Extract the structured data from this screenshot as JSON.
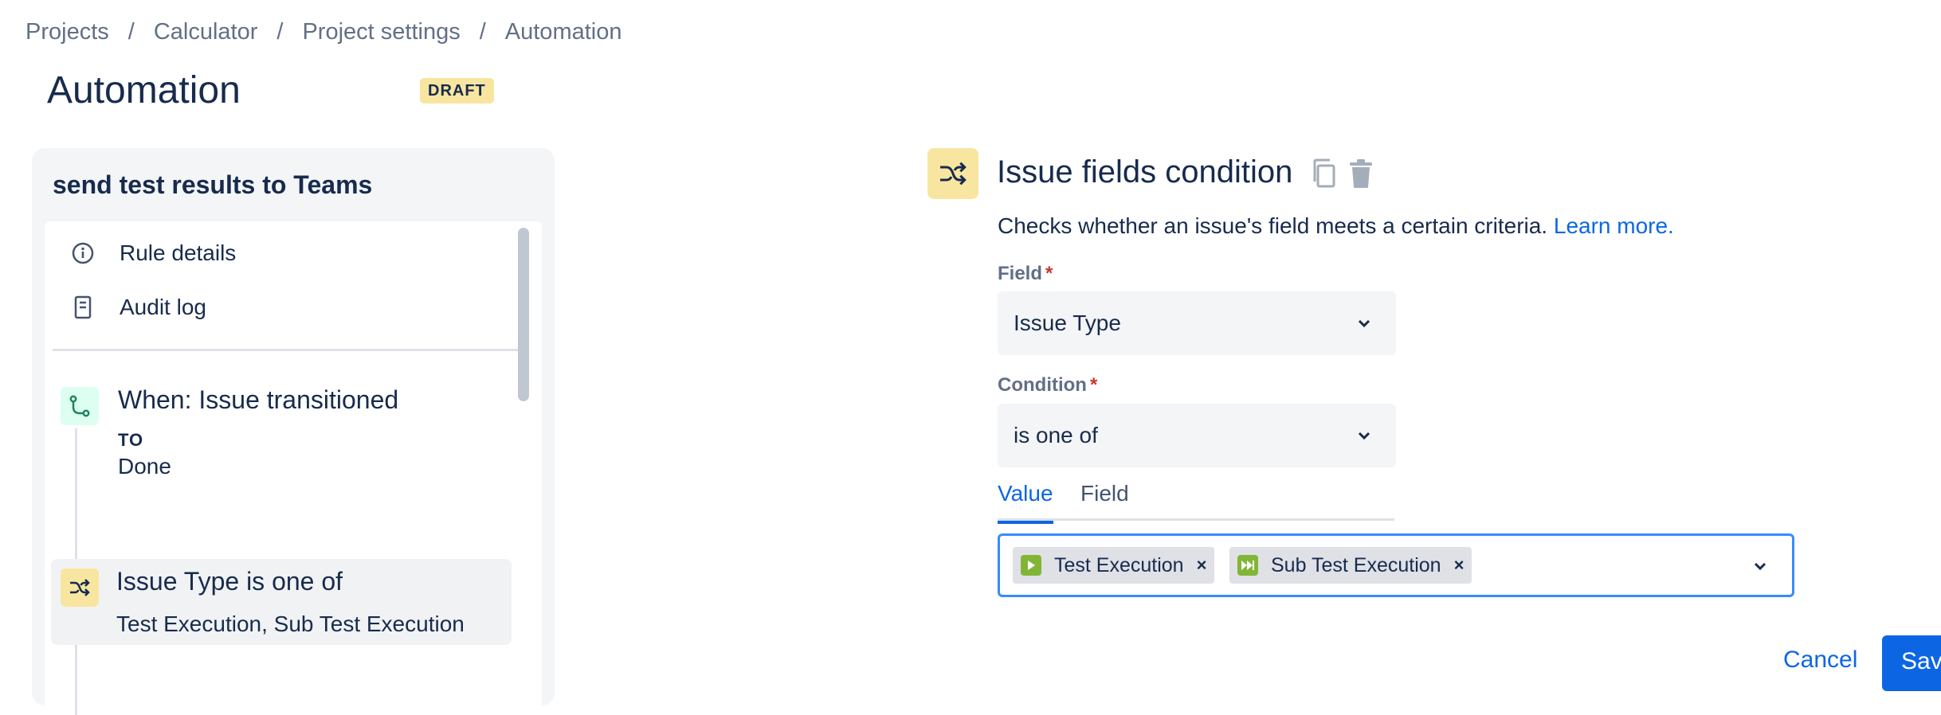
{
  "breadcrumb": {
    "items": [
      "Projects",
      "Calculator",
      "Project settings",
      "Automation"
    ],
    "separator": "/"
  },
  "page": {
    "title": "Automation",
    "status_badge": "DRAFT"
  },
  "rule_panel": {
    "rule_name": "send test results to Teams",
    "menu": [
      {
        "label": "Rule details",
        "icon": "info-icon"
      },
      {
        "label": "Audit log",
        "icon": "document-icon"
      }
    ],
    "trigger": {
      "icon": "transition-icon",
      "title": "When: Issue transitioned",
      "sub_label": "TO",
      "value": "Done"
    },
    "condition": {
      "icon": "shuffle-icon",
      "title": "Issue Type is one of",
      "summary": "Test Execution, Sub Test Execution"
    }
  },
  "detail": {
    "icon": "shuffle-icon",
    "title": "Issue fields condition",
    "description": "Checks whether an issue's field meets a certain criteria.",
    "learn_more": "Learn more.",
    "field_label": "Field",
    "field_value": "Issue Type",
    "condition_label": "Condition",
    "condition_value": "is one of",
    "required_marker": "*",
    "tabs": [
      "Value",
      "Field"
    ],
    "active_tab": "Value",
    "selected_values": [
      {
        "label": "Test Execution",
        "icon": "play-icon"
      },
      {
        "label": "Sub Test Execution",
        "icon": "fast-forward-icon"
      }
    ],
    "remove_glyph": "×"
  },
  "actions": {
    "cancel": "Cancel",
    "save": "Save"
  },
  "colors": {
    "accent": "#0C66E4",
    "condition_icon_bg": "#F8E6A0",
    "trigger_icon_bg": "#DCFFF1",
    "chip_icon": "#82B536",
    "focus_border": "#388BFF"
  }
}
